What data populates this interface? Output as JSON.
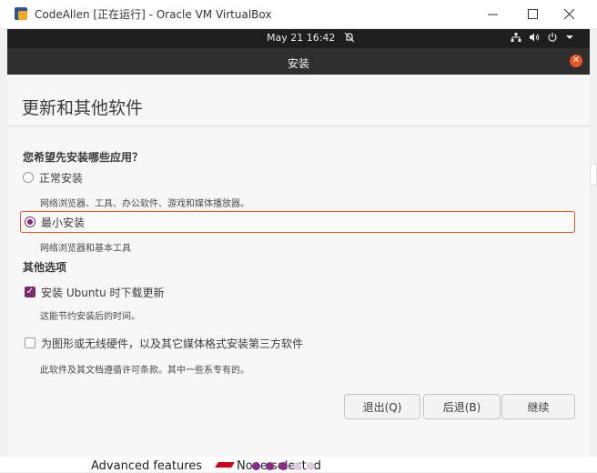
{
  "window": {
    "title": "CodeAllen [正在运行] - Oracle VM VirtualBox",
    "min_icon": "minimize-icon",
    "max_icon": "maximize-icon",
    "close_icon": "close-icon"
  },
  "gnome_bar": {
    "clock": "May 21  16:42",
    "bell_icon": "notifications-off-icon",
    "tray_icons": [
      "network-icon",
      "volume-icon",
      "power-icon",
      "chevron-down-icon"
    ]
  },
  "installer": {
    "header_title": "安装",
    "page_title": "更新和其他软件",
    "question": "您希望先安装哪些应用？",
    "options": [
      {
        "label": "正常安装",
        "description": "网络浏览器、工具、办公软件、游戏和媒体播放器。",
        "selected": false
      },
      {
        "label": "最小安装",
        "description": "网络浏览器和基本工具",
        "selected": true
      }
    ],
    "other_section": "其他选项",
    "checks": [
      {
        "label": "安装 Ubuntu 时下载更新",
        "description": "这能节约安装后的时间。",
        "checked": true
      },
      {
        "label": "为图形或无线硬件，以及其它媒体格式安装第三方软件",
        "description": "此软件及其文档遵循许可条款。其中一些系专有的。",
        "checked": false
      }
    ],
    "buttons": {
      "quit": "退出(Q)",
      "back": "后退(B)",
      "continue": "继续"
    }
  },
  "background": {
    "fragment_1": "Advanced features",
    "fragment_2": "None selected"
  },
  "colors": {
    "accent": "#e95420",
    "aubergine": "#7a2c6e",
    "topbar": "#1e1e1e",
    "header": "#2f2f2f"
  }
}
